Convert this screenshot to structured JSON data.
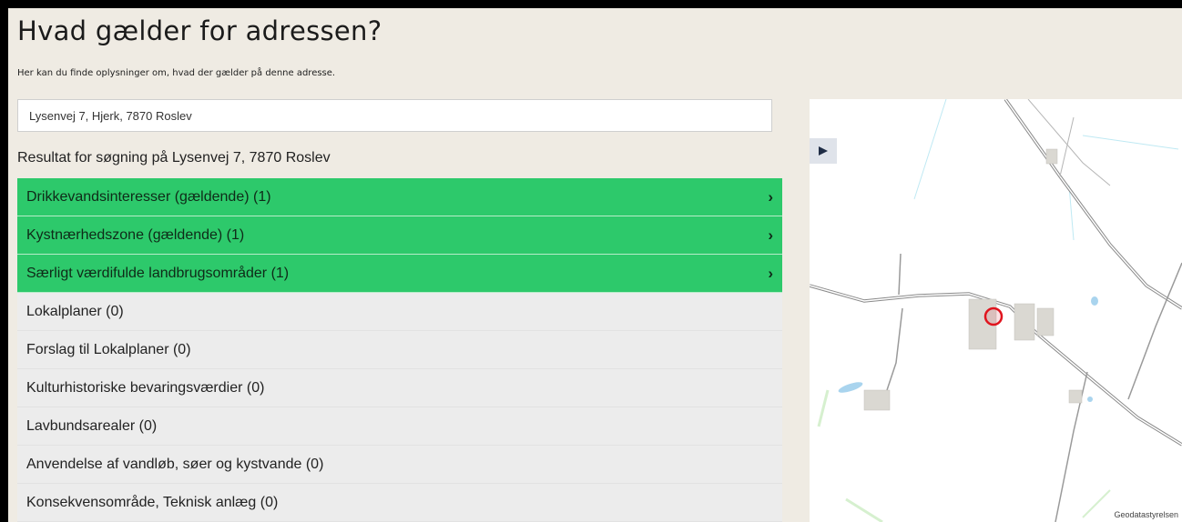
{
  "header": {
    "title": "Hvad gælder for adressen?",
    "subtitle": "Her kan du finde oplysninger om, hvad der gælder på denne adresse."
  },
  "search": {
    "value": "Lysenvej 7, Hjerk, 7870 Roslev"
  },
  "results": {
    "heading": "Resultat for søgning på Lysenvej 7, 7870 Roslev",
    "items": [
      {
        "label": "Drikkevandsinteresser (gældende) (1)",
        "active": true
      },
      {
        "label": "Kystnærhedszone (gældende) (1)",
        "active": true
      },
      {
        "label": "Særligt værdifulde landbrugsområder (1)",
        "active": true
      },
      {
        "label": "Lokalplaner (0)",
        "active": false
      },
      {
        "label": "Forslag til Lokalplaner (0)",
        "active": false
      },
      {
        "label": "Kulturhistoriske bevaringsværdier (0)",
        "active": false
      },
      {
        "label": "Lavbundsarealer (0)",
        "active": false
      },
      {
        "label": "Anvendelse af vandløb, søer og kystvande (0)",
        "active": false
      },
      {
        "label": "Konsekvensområde, Teknisk anlæg (0)",
        "active": false
      }
    ],
    "chevron_icon": "chevron-right-icon"
  },
  "map": {
    "attribution": "Geodatastyrelsen",
    "toggle_icon": "play-right-icon",
    "marker_color": "#e0141e"
  },
  "colors": {
    "active_row": "#2dc96b",
    "inactive_row": "#ececec",
    "background": "#efebe3"
  }
}
